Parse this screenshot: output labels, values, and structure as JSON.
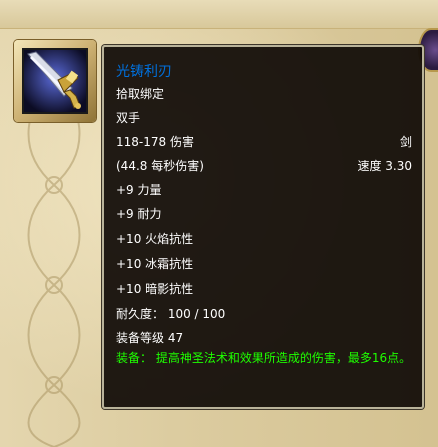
{
  "theme": {
    "item_quality_color": "#0070dd",
    "equip_color": "#1eff00",
    "text_color": "#ffffff",
    "tooltip_bg": "#0e0905",
    "border_color": "#b9b39a"
  },
  "item": {
    "icon": "two-handed-sword-icon",
    "name": "光铸利刃",
    "binding": "拾取绑定",
    "slot": "双手",
    "damage": "118-178 伤害",
    "weapon_type": "剑",
    "dps": "(44.8 每秒伤害)",
    "speed": "速度 3.30",
    "stats": [
      "+9 力量",
      "+9 耐力",
      "+10 火焰抗性",
      "+10 冰霜抗性",
      "+10 暗影抗性"
    ],
    "durability": "耐久度： 100 / 100",
    "item_level": "装备等级 47",
    "equip_effect": "装备： 提高神圣法术和效果所造成的伤害，最多16点。"
  }
}
